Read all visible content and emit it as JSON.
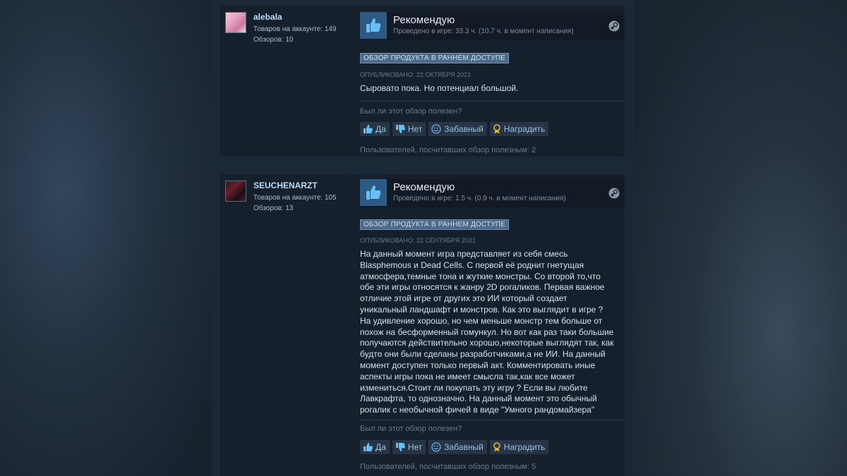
{
  "reviews": [
    {
      "username": "alebala",
      "products_label": "Товаров на аккаунте: 149",
      "reviews_label": "Обзоров: 10",
      "verdict": "Рекомендую",
      "hours": "Проведено в игре: 33.3 ч. (10.7 ч. в момент написания)",
      "early_access": "ОБЗОР ПРОДУКТА В РАННЕМ ДОСТУПЕ",
      "posted": "ОПУБЛИКОВАНО: 22 ОКТЯБРЯ 2021",
      "text": "Сыровато пока. Но потенциал большой.",
      "helpful_question": "Был ли этот обзор полезен?",
      "btn_yes": "Да",
      "btn_no": "Нет",
      "btn_funny": "Забавный",
      "btn_award": "Наградить",
      "helpful_count": "Пользователей, посчитавших обзор полезным: 2"
    },
    {
      "username": "SEUCHENARZT",
      "products_label": "Товаров на аккаунте: 105",
      "reviews_label": "Обзоров: 13",
      "verdict": "Рекомендую",
      "hours": "Проведено в игре: 1.5 ч. (0.9 ч. в момент написания)",
      "early_access": "ОБЗОР ПРОДУКТА В РАННЕМ ДОСТУПЕ",
      "posted": "ОПУБЛИКОВАНО: 22 СЕНТЯБРЯ 2021",
      "text_lines": [
        "На данный момент игра представляет из себя смесь",
        "Blasphemous и Dead Cells. С первой её роднит гнетущая",
        "атмосфера,темные тона и жуткие монстры. Со второй то,что",
        "обе эти игры относятся к жанру 2D рогаликов. Первая важное",
        "отличие этой игре от других это ИИ который создает",
        "уникальный ландшафт и монстров. Как это выглядит в игре ?",
        "На удивление хорошо, но чем меньше монстр тем больше от",
        "похож на бесформенный гомункул. Но вот как раз таки большие",
        "получаются действительно хорошо,некоторые выглядят так, как",
        "будто они были сделаны разработчиками,а не ИИ. На данный",
        "момент доступен только первый акт. Комментировать иные",
        "аспекты игры пока не имеет смысла так,как все может",
        "измениться.Стоит ли покупать эту игру ? Если вы любите",
        "Лавкрафта, то однозначно. На данный момент это обычный",
        "рогалик с необычной фичей в виде \"Умного рандомайзера\""
      ],
      "helpful_question": "Был ли этот обзор полезен?",
      "btn_yes": "Да",
      "btn_no": "Нет",
      "btn_funny": "Забавный",
      "btn_award": "Наградить",
      "helpful_count": "Пользователей, посчитавших обзор полезным: 5"
    }
  ],
  "icons": {
    "thumb": "thumbs-up-icon",
    "steam": "steam-icon",
    "yes": "thumbs-up-small-icon",
    "no": "thumbs-down-small-icon",
    "funny": "smiley-icon",
    "award": "award-icon"
  },
  "colors": {
    "accent": "#c1dbf4",
    "thumb_bg": "#2d5a84",
    "award": "#e7b53a"
  }
}
